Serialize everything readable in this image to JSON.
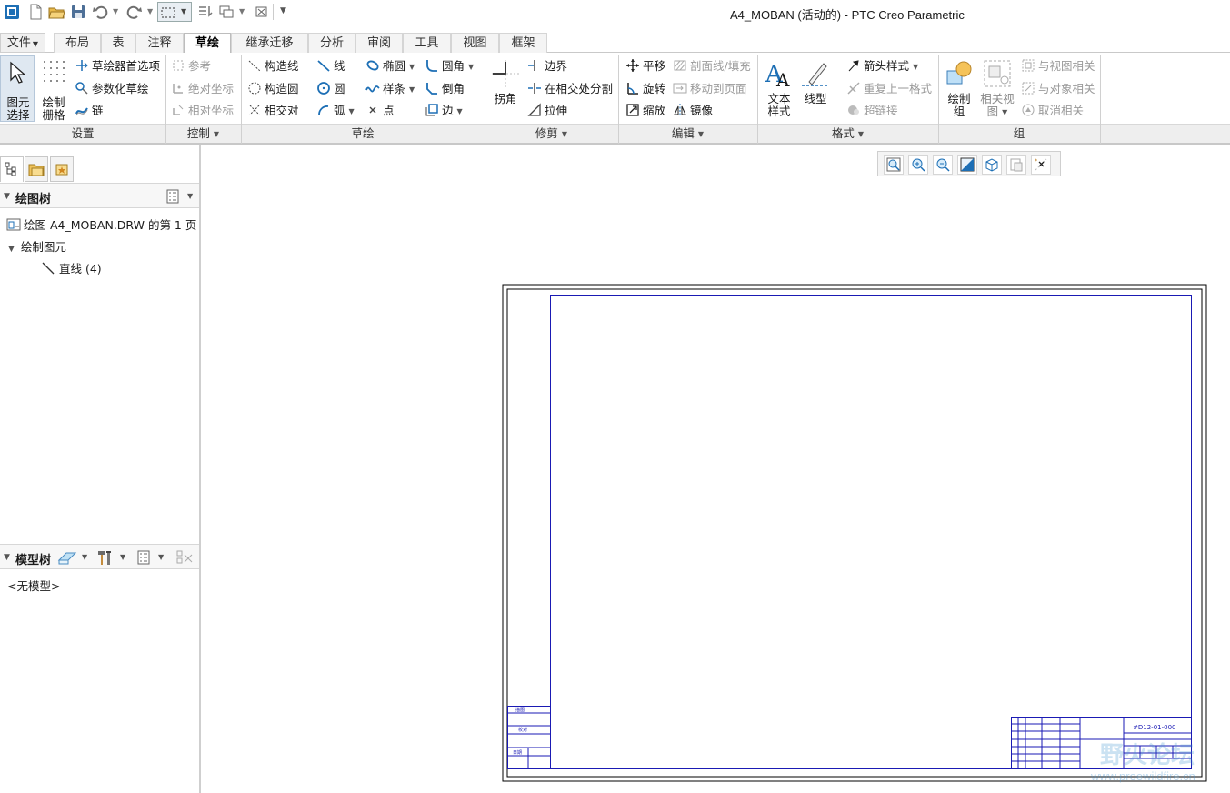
{
  "window": {
    "title": "A4_MOBAN (活动的) - PTC Creo Parametric"
  },
  "ribbon": {
    "tabs": [
      {
        "label": "文件"
      },
      {
        "label": "布局"
      },
      {
        "label": "表"
      },
      {
        "label": "注释"
      },
      {
        "label": "草绘",
        "active": true
      },
      {
        "label": "继承迁移"
      },
      {
        "label": "分析"
      },
      {
        "label": "审阅"
      },
      {
        "label": "工具"
      },
      {
        "label": "视图"
      },
      {
        "label": "框架"
      }
    ],
    "groups": {
      "setup": {
        "label": "设置",
        "select": "图元\n选择",
        "select_l1": "图元",
        "select_l2": "选择",
        "grid_l1": "绘制",
        "grid_l2": "栅格",
        "sketcher_prefs": "草绘器首选项",
        "param_sketch": "参数化草绘",
        "chain": "链"
      },
      "control": {
        "label": "控制",
        "reference": "参考",
        "abs_coords": "绝对坐标",
        "rel_coords": "相对坐标"
      },
      "sketch": {
        "label": "草绘",
        "construction_line": "构造线",
        "construction_circle": "构造圆",
        "intersect": "相交对",
        "line": "线",
        "circle": "圆",
        "arc": "弧",
        "ellipse": "椭圆",
        "spline": "样条",
        "point": "点",
        "fillet": "圆角",
        "chamfer": "倒角",
        "edge": "边"
      },
      "trim": {
        "label": "修剪",
        "corner": "拐角",
        "boundary": "边界",
        "divide": "在相交处分割",
        "stretch": "拉伸"
      },
      "edit": {
        "label": "编辑",
        "translate": "平移",
        "rotate": "旋转",
        "scale": "缩放",
        "hatch": "剖面线/填充",
        "move_to_sheet": "移动到页面",
        "mirror": "镜像"
      },
      "format": {
        "label": "格式",
        "text_style_l1": "文本",
        "text_style_l2": "样式",
        "linestyle": "线型",
        "arrow_style": "箭头样式",
        "repeat_format": "重复上一格式",
        "hyperlink": "超链接"
      },
      "group": {
        "label": "组",
        "draw_group_l1": "绘制",
        "draw_group_l2": "组",
        "relate_view_l1": "相关视",
        "relate_view_l2": "图",
        "relate_to_view": "与视图相关",
        "relate_to_object": "与对象相关",
        "unrelate": "取消相关"
      }
    }
  },
  "drawing_tree": {
    "title": "绘图树",
    "items": [
      {
        "label": "绘图 A4_MOBAN.DRW 的第 1 页"
      },
      {
        "label": "绘制图元"
      },
      {
        "label": "直线 (4)"
      }
    ]
  },
  "model_tree": {
    "title": "模型树",
    "empty": "<无模型>"
  },
  "watermark": {
    "text": "野火论坛",
    "url": "www.proewildfire.cn"
  },
  "title_block": {
    "drawing_no": "#D12-01-000",
    "left_labels": [
      "描图",
      "校对",
      "日期"
    ]
  },
  "colors": {
    "drawing_line": "#1a1ab4",
    "active_tab": "#ffffff"
  }
}
